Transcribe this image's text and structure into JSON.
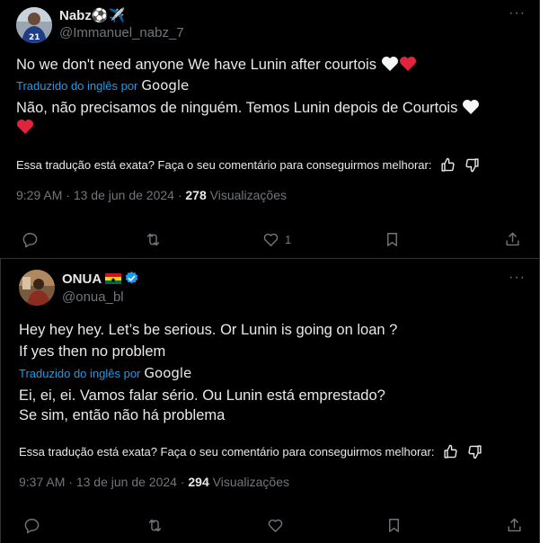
{
  "tweets": [
    {
      "name": "Nabz",
      "name_emojis": "⚽✈️",
      "handle": "@Immanuel_nabz_7",
      "text": "No we don't need anyone We have Lunin after courtois",
      "translated_label": "Traduzido do inglês por",
      "translator": "Google",
      "translation": "Não, não precisamos de ninguém. Temos Lunin depois de Courtois",
      "feedback_question": "Essa tradução está exata? Faça o seu comentário para conseguirmos melhorar:",
      "time": "9:29 AM",
      "date": "13 de jun de 2024",
      "views": "278",
      "views_label": "Visualizações",
      "like_count": "1"
    },
    {
      "name": "ONUA",
      "handle": "@onua_bl",
      "text_line1": "Hey hey hey. Let’s be serious. Or Lunin is going on loan ?",
      "text_line2": "If yes then no problem",
      "translated_label": "Traduzido do inglês por",
      "translator": "Google",
      "translation_line1": "Ei, ei, ei. Vamos falar sério. Ou Lunin está emprestado?",
      "translation_line2": "Se sim, então não há problema",
      "feedback_question": "Essa tradução está exata? Faça o seu comentário para conseguirmos melhorar:",
      "time": "9:37 AM",
      "date": "13 de jun de 2024",
      "views": "294",
      "views_label": "Visualizações"
    }
  ],
  "separator": "·",
  "more_glyph": "···",
  "icons": {
    "reply": "reply-icon",
    "retweet": "retweet-icon",
    "like": "heart-icon",
    "bookmark": "bookmark-icon",
    "share": "share-icon",
    "thumbs_up": "thumbs-up-icon",
    "thumbs_down": "thumbs-down-icon",
    "verified": "verified-badge-icon"
  },
  "colors": {
    "background": "#000000",
    "link": "#1d9bf0",
    "muted": "#71767b",
    "text": "#e7e9ea",
    "verified": "#1d9bf0"
  }
}
